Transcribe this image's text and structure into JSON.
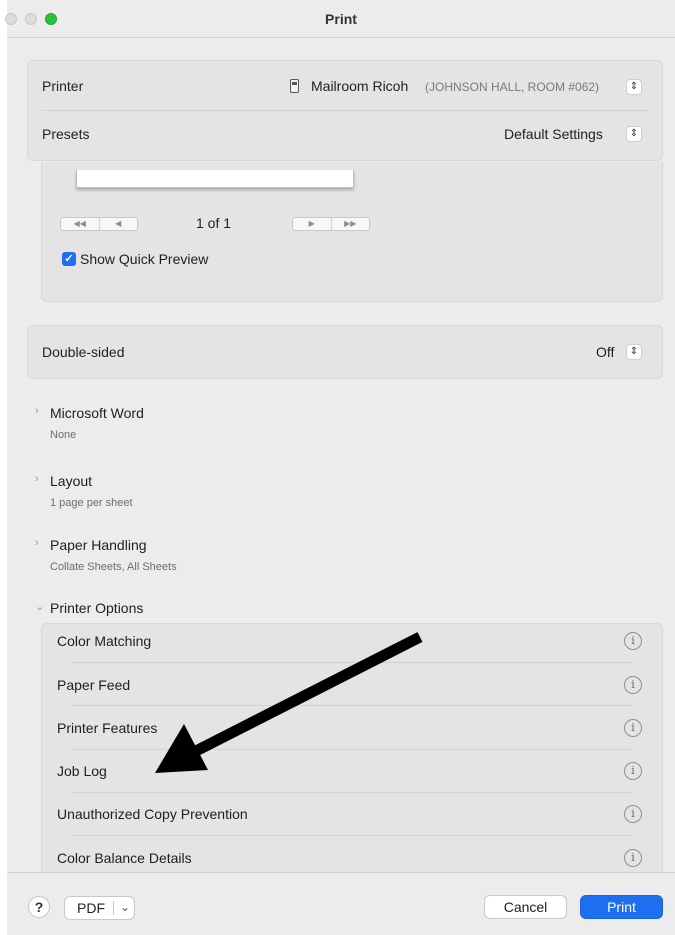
{
  "window": {
    "title": "Print"
  },
  "printer": {
    "label": "Printer",
    "name": "Mailroom Ricoh",
    "location": "(JOHNSON HALL, ROOM #062)",
    "presets_label": "Presets",
    "presets_value": "Default Settings"
  },
  "preview": {
    "page_indicator": "1 of 1",
    "show_quick_preview_label": "Show Quick Preview",
    "show_quick_preview_checked": true
  },
  "double_sided": {
    "label": "Double-sided",
    "value": "Off"
  },
  "sections": [
    {
      "title": "Microsoft Word",
      "subtitle": "None"
    },
    {
      "title": "Layout",
      "subtitle": "1 page per sheet"
    },
    {
      "title": "Paper Handling",
      "subtitle": "Collate Sheets, All Sheets"
    }
  ],
  "printer_options": {
    "title": "Printer Options",
    "items": [
      "Color Matching",
      "Paper Feed",
      "Printer Features",
      "Job Log",
      "Unauthorized Copy Prevention",
      "Color Balance Details"
    ]
  },
  "footer": {
    "help_label": "?",
    "pdf_label": "PDF",
    "cancel_label": "Cancel",
    "print_label": "Print"
  },
  "colors": {
    "accent": "#1d6ff0",
    "zoom_button": "#2ac33f",
    "annotation_arrow": "#000000"
  }
}
